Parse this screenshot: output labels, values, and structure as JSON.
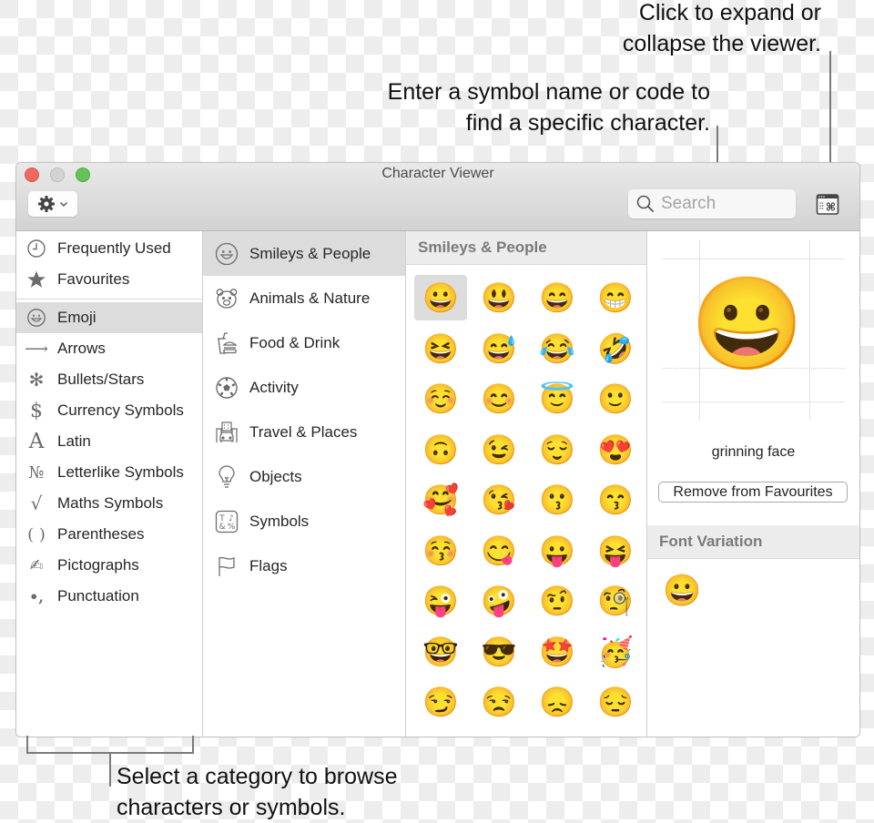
{
  "callouts": {
    "expand": [
      "Click to expand or",
      "collapse the viewer."
    ],
    "search": [
      "Enter a symbol name or code to",
      "find a specific character."
    ],
    "category": [
      "Select a category to browse",
      "characters or symbols."
    ]
  },
  "window": {
    "title": "Character Viewer",
    "search_placeholder": "Search",
    "action_menu": "gear-icon"
  },
  "sidebar": {
    "top_items": [
      {
        "label": "Frequently Used",
        "icon": "clock-icon"
      },
      {
        "label": "Favourites",
        "icon": "star-icon"
      }
    ],
    "items": [
      {
        "label": "Emoji",
        "icon": "smiley-icon",
        "selected": true
      },
      {
        "label": "Arrows",
        "icon": "arrow-icon",
        "glyph": "⟶"
      },
      {
        "label": "Bullets/Stars",
        "icon": "asterisk-icon",
        "glyph": "✻"
      },
      {
        "label": "Currency Symbols",
        "icon": "dollar-icon",
        "glyph": "$"
      },
      {
        "label": "Latin",
        "icon": "latin-a-icon",
        "glyph": "A"
      },
      {
        "label": "Letterlike Symbols",
        "icon": "numero-icon",
        "glyph": "№"
      },
      {
        "label": "Maths Symbols",
        "icon": "square-root-icon",
        "glyph": "√"
      },
      {
        "label": "Parentheses",
        "icon": "parentheses-icon",
        "glyph": "( )"
      },
      {
        "label": "Pictographs",
        "icon": "writing-hand-icon",
        "glyph": "✍"
      },
      {
        "label": "Punctuation",
        "icon": "punctuation-icon",
        "glyph": "•,"
      }
    ]
  },
  "categories": [
    {
      "label": "Smileys & People",
      "icon": "smiley-icon",
      "selected": true
    },
    {
      "label": "Animals & Nature",
      "icon": "bear-icon"
    },
    {
      "label": "Food & Drink",
      "icon": "burger-drink-icon"
    },
    {
      "label": "Activity",
      "icon": "soccer-ball-icon"
    },
    {
      "label": "Travel & Places",
      "icon": "car-building-icon"
    },
    {
      "label": "Objects",
      "icon": "lightbulb-icon"
    },
    {
      "label": "Symbols",
      "icon": "symbols-icon"
    },
    {
      "label": "Flags",
      "icon": "flag-icon"
    }
  ],
  "grid": {
    "header": "Smileys & People",
    "emojis": [
      "😀",
      "😃",
      "😄",
      "😁",
      "😆",
      "😅",
      "😂",
      "🤣",
      "☺️",
      "😊",
      "😇",
      "🙂",
      "🙃",
      "😉",
      "😌",
      "😍",
      "🥰",
      "😘",
      "😗",
      "😙",
      "😚",
      "😋",
      "😛",
      "😝",
      "😜",
      "🤪",
      "🤨",
      "🧐",
      "🤓",
      "😎",
      "🤩",
      "🥳",
      "😏",
      "😒",
      "😞",
      "😔"
    ],
    "selected_index": 0
  },
  "detail": {
    "glyph": "😀",
    "name": "grinning face",
    "favourite_button": "Remove from Favourites",
    "font_variation_header": "Font Variation",
    "variations": [
      "😀"
    ]
  }
}
